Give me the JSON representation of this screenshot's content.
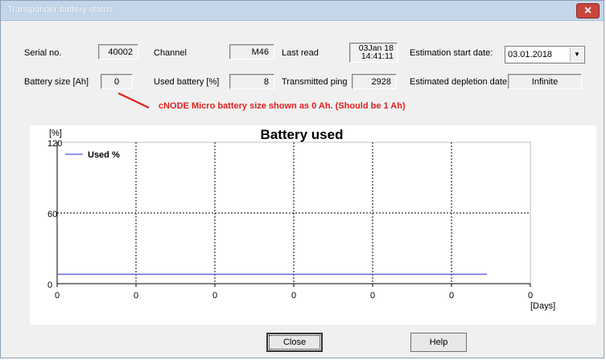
{
  "window": {
    "title": "Transponder battery status",
    "close_glyph": "✕"
  },
  "fields": {
    "serial_label": "Serial no.",
    "serial_value": "40002",
    "channel_label": "Channel",
    "channel_value": "M46",
    "lastread_label": "Last read",
    "lastread_line1": "03Jan 18",
    "lastread_line2": "14:41:11",
    "est_start_label": "Estimation start date:",
    "est_start_value": "03.01.2018",
    "battsize_label": "Battery size [Ah]",
    "battsize_value": "0",
    "usedbatt_label": "Used battery [%]",
    "usedbatt_value": "8",
    "txping_label": "Transmitted ping",
    "txping_value": "2928",
    "depletion_label": "Estimated depletion date:",
    "depletion_value": "Infinite"
  },
  "annotation": {
    "text": "cNODE Micro battery size shown as 0 Ah. (Should be 1 Ah)",
    "color": "#e02020"
  },
  "buttons": {
    "close": "Close",
    "help": "Help"
  },
  "chart_data": {
    "type": "line",
    "title": "Battery used",
    "ylabel": "[%]",
    "xlabel": "[Days]",
    "ylim": [
      0,
      120
    ],
    "xlim": [
      0,
      6
    ],
    "yticks": [
      "0",
      "60",
      "120"
    ],
    "xticks": [
      "0",
      "0",
      "0",
      "0",
      "0",
      "0",
      "0"
    ],
    "grid": true,
    "legend": "top-left",
    "series": [
      {
        "name": "Used %",
        "color": "#5050e0",
        "x": [
          0,
          5.45
        ],
        "y": [
          8,
          8
        ]
      }
    ]
  }
}
